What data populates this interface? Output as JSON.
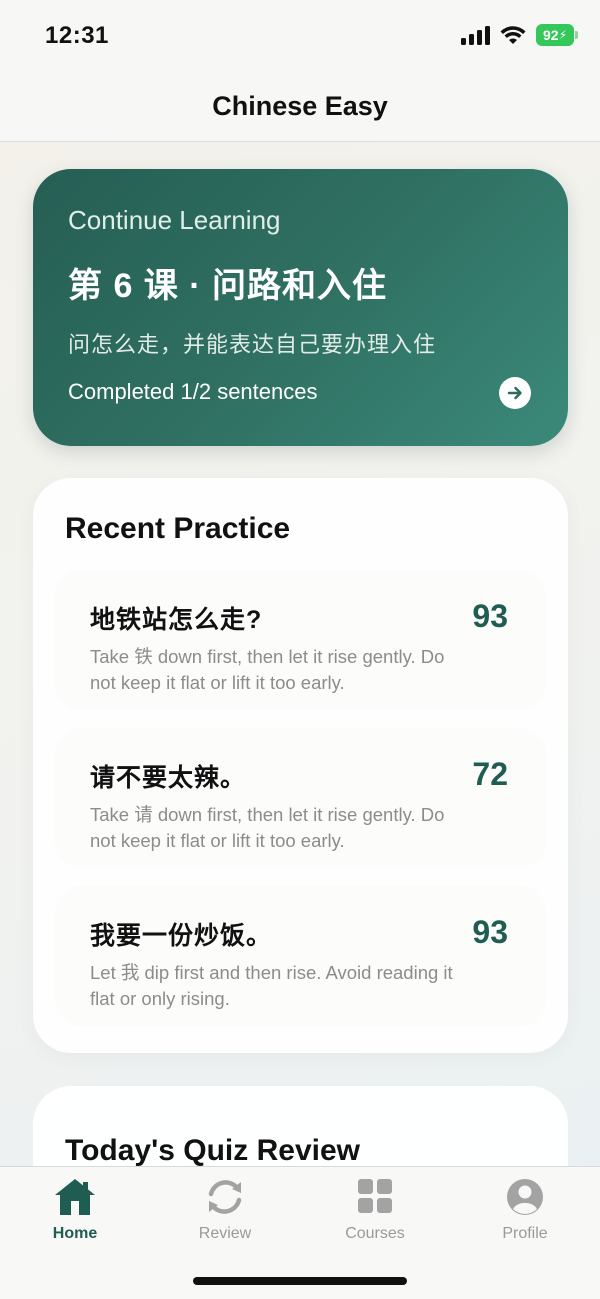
{
  "status_bar": {
    "time": "12:31",
    "battery": "92"
  },
  "nav": {
    "title": "Chinese Easy"
  },
  "continue_learning": {
    "label": "Continue Learning",
    "lesson_title": "第 6 课 · 问路和入住",
    "description": "问怎么走，并能表达自己要办理入住",
    "progress": "Completed 1/2 sentences"
  },
  "recent_practice": {
    "title": "Recent Practice",
    "items": [
      {
        "sentence": "地铁站怎么走?",
        "hint": "Take 铁 down first, then let it rise gently. Do not keep it flat or lift it too early.",
        "score": "93"
      },
      {
        "sentence": "请不要太辣。",
        "hint": "Take 请 down first, then let it rise gently. Do not keep it flat or lift it too early.",
        "score": "72"
      },
      {
        "sentence": "我要一份炒饭。",
        "hint": "Let 我 dip first and then rise. Avoid reading it flat or only rising.",
        "score": "93"
      }
    ]
  },
  "quiz_review": {
    "title": "Today's Quiz Review"
  },
  "tab_bar": {
    "tabs": [
      {
        "label": "Home",
        "icon": "home-icon",
        "active": true
      },
      {
        "label": "Review",
        "icon": "refresh-icon",
        "active": false
      },
      {
        "label": "Courses",
        "icon": "grid-icon",
        "active": false
      },
      {
        "label": "Profile",
        "icon": "person-icon",
        "active": false
      }
    ]
  },
  "colors": {
    "accent": "#1f5c52",
    "battery": "#34c759"
  }
}
